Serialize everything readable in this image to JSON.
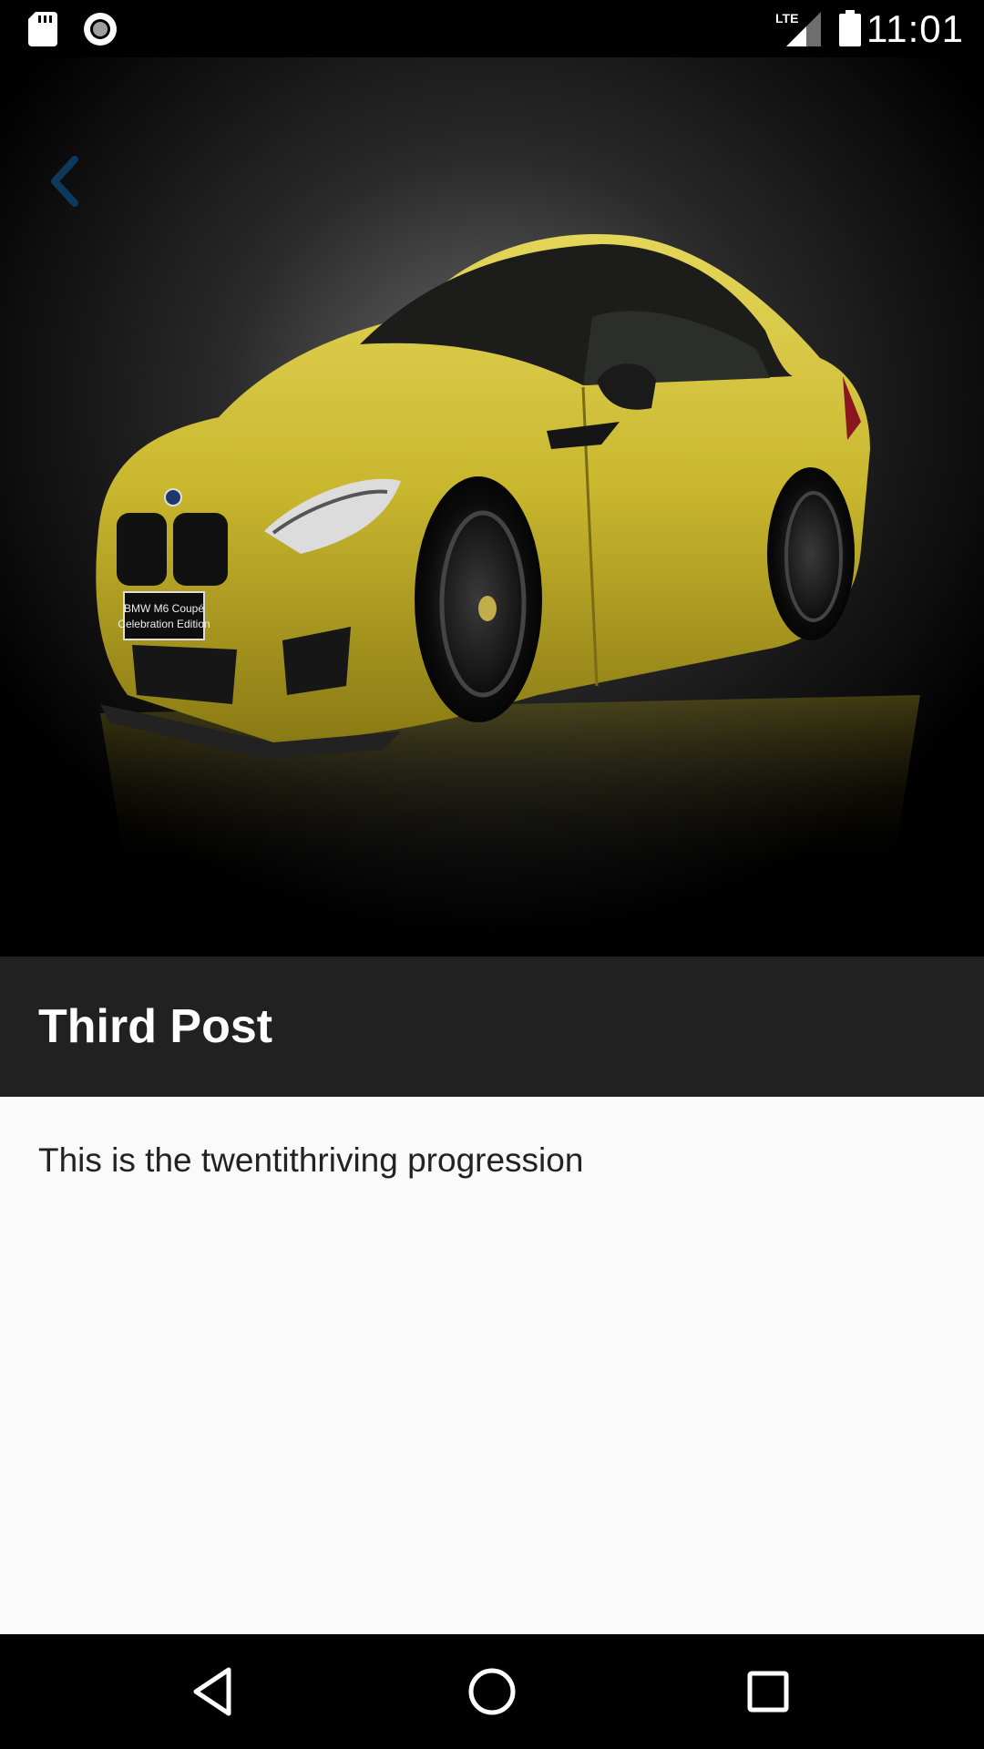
{
  "status_bar": {
    "time": "11:01",
    "icons": [
      "sd-card-icon",
      "record-icon",
      "lte-signal-icon",
      "battery-icon"
    ],
    "network": "LTE"
  },
  "hero": {
    "image_subject": "yellow BMW M6 coupe",
    "plate_line1": "BMW M6 Coupé",
    "plate_line2": "Celebration Edition",
    "back_icon": "chevron-left-icon",
    "back_color": "#0d3a5c"
  },
  "post": {
    "title": "Third Post",
    "body": "This is the twentithriving progression"
  },
  "nav_bar": {
    "icons": [
      "nav-back-icon",
      "nav-home-icon",
      "nav-recents-icon"
    ]
  },
  "colors": {
    "title_bar_bg": "#212121",
    "content_bg": "#fafafa",
    "car_paint": "#c9b72e"
  }
}
